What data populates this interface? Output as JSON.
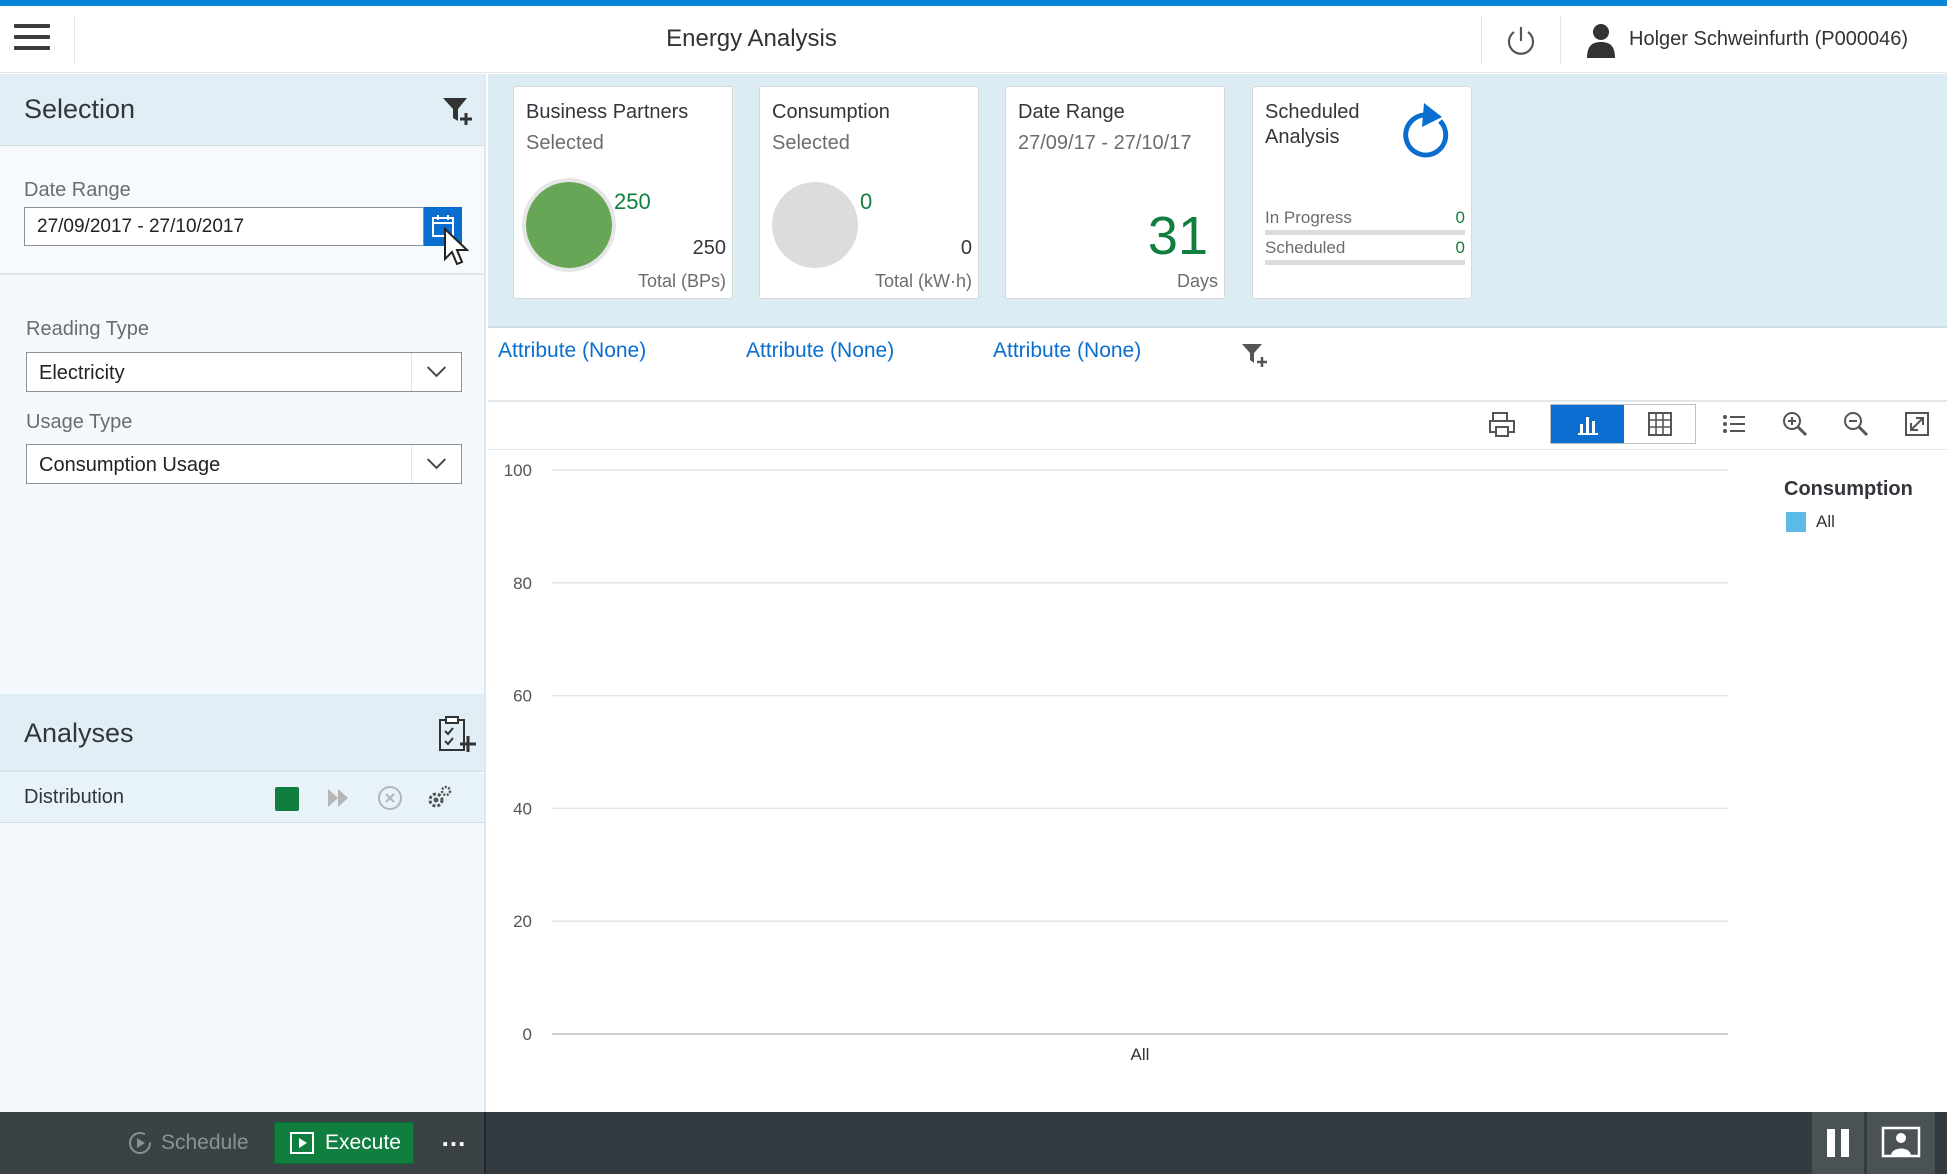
{
  "shell": {
    "title": "Energy Analysis",
    "user_name": "Holger Schweinfurth (P000046)"
  },
  "selection": {
    "title": "Selection",
    "date_range_label": "Date Range",
    "date_range_value": "27/09/2017 - 27/10/2017",
    "reading_type_label": "Reading Type",
    "reading_type_value": "Electricity",
    "usage_type_label": "Usage Type",
    "usage_type_value": "Consumption Usage"
  },
  "analyses": {
    "title": "Analyses",
    "items": [
      {
        "name": "Distribution",
        "status_color": "#107e3e"
      }
    ]
  },
  "footer": {
    "schedule_label": "Schedule",
    "execute_label": "Execute",
    "more_label": "..."
  },
  "tiles": {
    "business_partners": {
      "title": "Business Partners",
      "subtitle": "Selected",
      "selected_value": "250",
      "total_value": "250",
      "footer": "Total (BPs)",
      "fill_fraction": 1.0
    },
    "consumption": {
      "title": "Consumption",
      "subtitle": "Selected",
      "selected_value": "0",
      "total_value": "0",
      "footer": "Total (kW·h)",
      "fill_fraction": 0.0
    },
    "date_range": {
      "title": "Date Range",
      "subtitle": "27/09/17 - 27/10/17",
      "value": "31",
      "footer": "Days"
    },
    "scheduled": {
      "title_line1": "Scheduled",
      "title_line2": "Analysis",
      "in_progress_label": "In Progress",
      "in_progress_value": "0",
      "scheduled_label": "Scheduled",
      "scheduled_value": "0"
    }
  },
  "attributes": [
    "Attribute (None)",
    "Attribute (None)",
    "Attribute (None)"
  ],
  "colors": {
    "accent": "#0a6ed1",
    "positive": "#107e3e",
    "series": "#5cbae6",
    "neutral_donut": "#dcdcdc"
  },
  "chart_data": {
    "type": "bar",
    "categories": [
      "All"
    ],
    "series": [
      {
        "name": "All",
        "values": [
          0
        ]
      }
    ],
    "legend_title": "Consumption",
    "legend_placement": "top-right",
    "y_ticks": [
      0,
      20,
      40,
      60,
      80,
      100
    ],
    "ylim": [
      0,
      100
    ],
    "grid": true
  }
}
